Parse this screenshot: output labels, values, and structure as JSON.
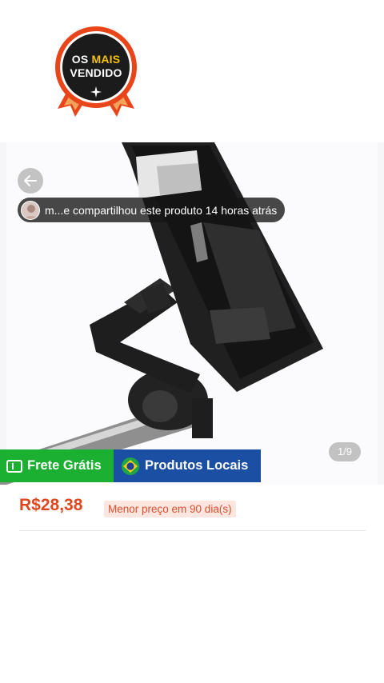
{
  "badge": {
    "line1_prefix": "OS ",
    "line1_highlight": "MAIS",
    "line2": "VENDIDO",
    "icon": "sparkle-icon"
  },
  "gallery": {
    "share_text": "m...e compartilhou este produto 14 horas atrás",
    "counter": "1/9",
    "back_icon": "arrow-left-icon"
  },
  "promo": {
    "free_shipping": "Frete Grátis",
    "local_products": "Produtos Locais",
    "colors": {
      "free": "#1cb032",
      "local": "#1a4fa3"
    }
  },
  "pricing": {
    "price": "R$28,38",
    "lowest_label": "Menor preço em 90 dia(s)",
    "color": "#e0461e"
  }
}
